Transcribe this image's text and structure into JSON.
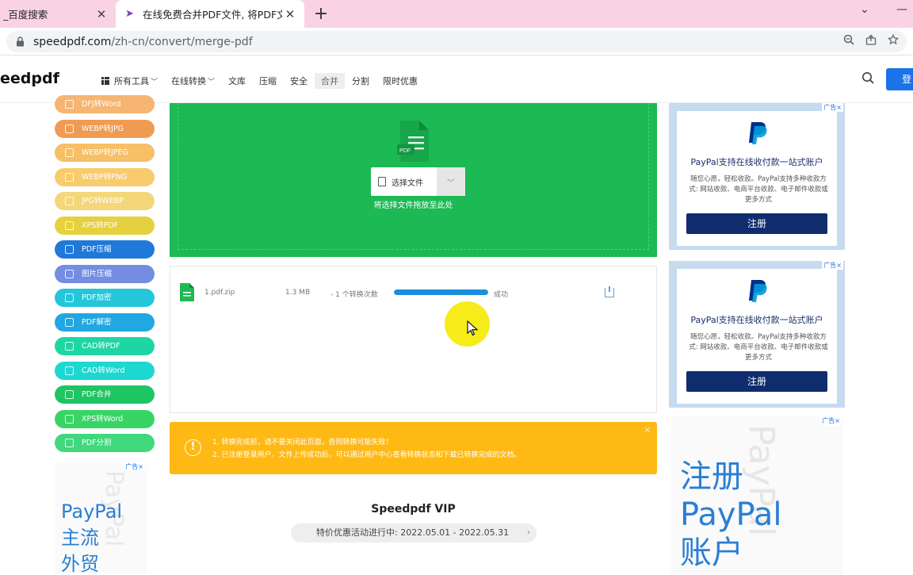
{
  "browser": {
    "tabs": [
      {
        "title": "_百度搜索",
        "active": false
      },
      {
        "title": "在线免费合并PDF文件, 将PDF文",
        "active": true
      }
    ],
    "url_host": "speedpdf.com",
    "url_path": "/zh-cn/convert/merge-pdf"
  },
  "header": {
    "logo": "eedpdf",
    "nav": [
      "所有工具",
      "在线转换",
      "文库",
      "压缩",
      "安全",
      "合并",
      "分割",
      "限时优惠"
    ],
    "active_nav": "合并",
    "login_label": "登"
  },
  "sidebar": {
    "tools": [
      {
        "label": "DFJ转Word",
        "color": "#f6b26b"
      },
      {
        "label": "WEBP转JPG",
        "color": "#f0964a"
      },
      {
        "label": "WEBP转JPEG",
        "color": "#f7bc5e"
      },
      {
        "label": "WEBP转PNG",
        "color": "#f8c965"
      },
      {
        "label": "JPG转WEBP",
        "color": "#f3d571"
      },
      {
        "label": "XPS转PDF",
        "color": "#e4cf35"
      },
      {
        "label": "PDF压缩",
        "color": "#1571d6"
      },
      {
        "label": "图片压缩",
        "color": "#6d86e0"
      },
      {
        "label": "PDF加密",
        "color": "#19c3d8"
      },
      {
        "label": "PDF解密",
        "color": "#16a3e0"
      },
      {
        "label": "CAD转PDF",
        "color": "#12d4a0"
      },
      {
        "label": "CAD转Word",
        "color": "#10d6cf"
      },
      {
        "label": "PDF合并",
        "color": "#12c25a"
      },
      {
        "label": "XPS转Word",
        "color": "#2fd35c"
      },
      {
        "label": "PDF分割",
        "color": "#35d675"
      }
    ]
  },
  "upload": {
    "choose_label": "选择文件",
    "drop_hint": "将选择文件拖放至此处"
  },
  "files": [
    {
      "name": "1.pdf.zip",
      "size": "1.3 MB",
      "count": "- 1 个转换次数",
      "progress": 1.0,
      "status": "成功"
    }
  ],
  "notice": {
    "lines": [
      "1. 转换完成前，请不要关闭此页面，否则转换可能失败！",
      "2. 已注册登录用户，文件上传成功后，可以通过用户中心查看转换状态和下载已转换完成的文档。"
    ],
    "close": "×",
    "icon": "!"
  },
  "vip": {
    "title": "Speedpdf VIP",
    "promo": "特价优惠活动进行中: 2022.05.01 - 2022.05.31"
  },
  "ads": {
    "choice": "广告×",
    "headline": "PayPal支持在线收付款一站式账户",
    "body": "随您心愿，轻松收款。PayPal支持多种收款方式: 网站收款、电商平台收款、电子邮件收款或更多方式",
    "button": "注册",
    "big_lines": [
      "注册",
      "PayPal",
      "账户"
    ],
    "small_lines": [
      "PayPal",
      "主流",
      "外贸"
    ],
    "ghost": "PayPal"
  }
}
